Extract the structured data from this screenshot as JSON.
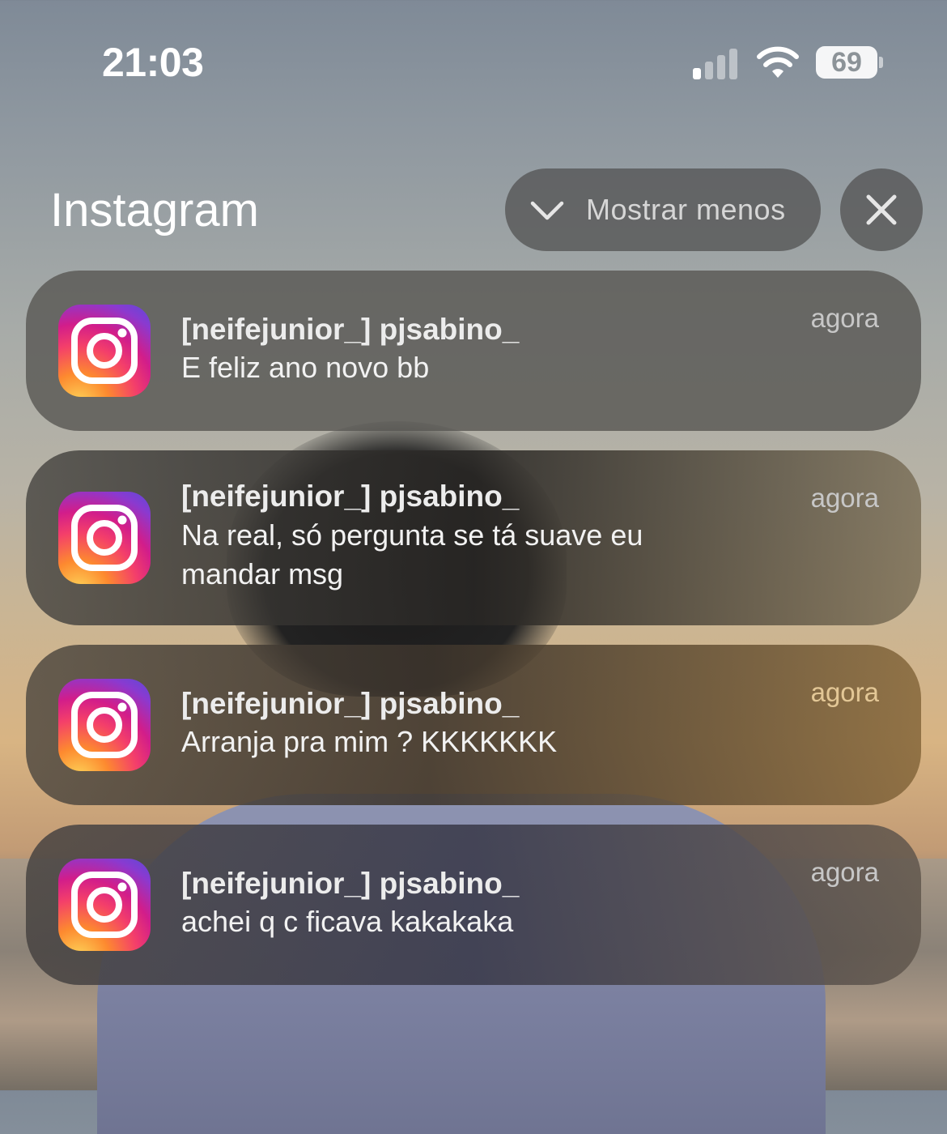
{
  "status_bar": {
    "time": "21:03",
    "battery_level": "69",
    "signal_bars_active": 1,
    "signal_bars_total": 4
  },
  "group": {
    "app_name": "Instagram",
    "show_less_label": "Mostrar menos",
    "show_less_icon": "chevron-down-icon",
    "close_icon": "close-icon"
  },
  "notifications": [
    {
      "icon": "instagram-icon",
      "title": "[neifejunior_] pjsabino_",
      "body": "E feliz ano novo bb",
      "time": "agora"
    },
    {
      "icon": "instagram-icon",
      "title": "[neifejunior_] pjsabino_",
      "body": "Na real, só pergunta se tá suave eu mandar msg",
      "time": "agora"
    },
    {
      "icon": "instagram-icon",
      "title": "[neifejunior_] pjsabino_",
      "body": "Arranja pra mim ? KKKKKKK",
      "time": "agora"
    },
    {
      "icon": "instagram-icon",
      "title": "[neifejunior_] pjsabino_",
      "body": "achei q c ficava kakakaka",
      "time": "agora"
    }
  ],
  "colors": {
    "card": "#575552",
    "pill": "#555555",
    "text_primary": "#ffffff",
    "text_secondary": "#c7c7c7"
  }
}
